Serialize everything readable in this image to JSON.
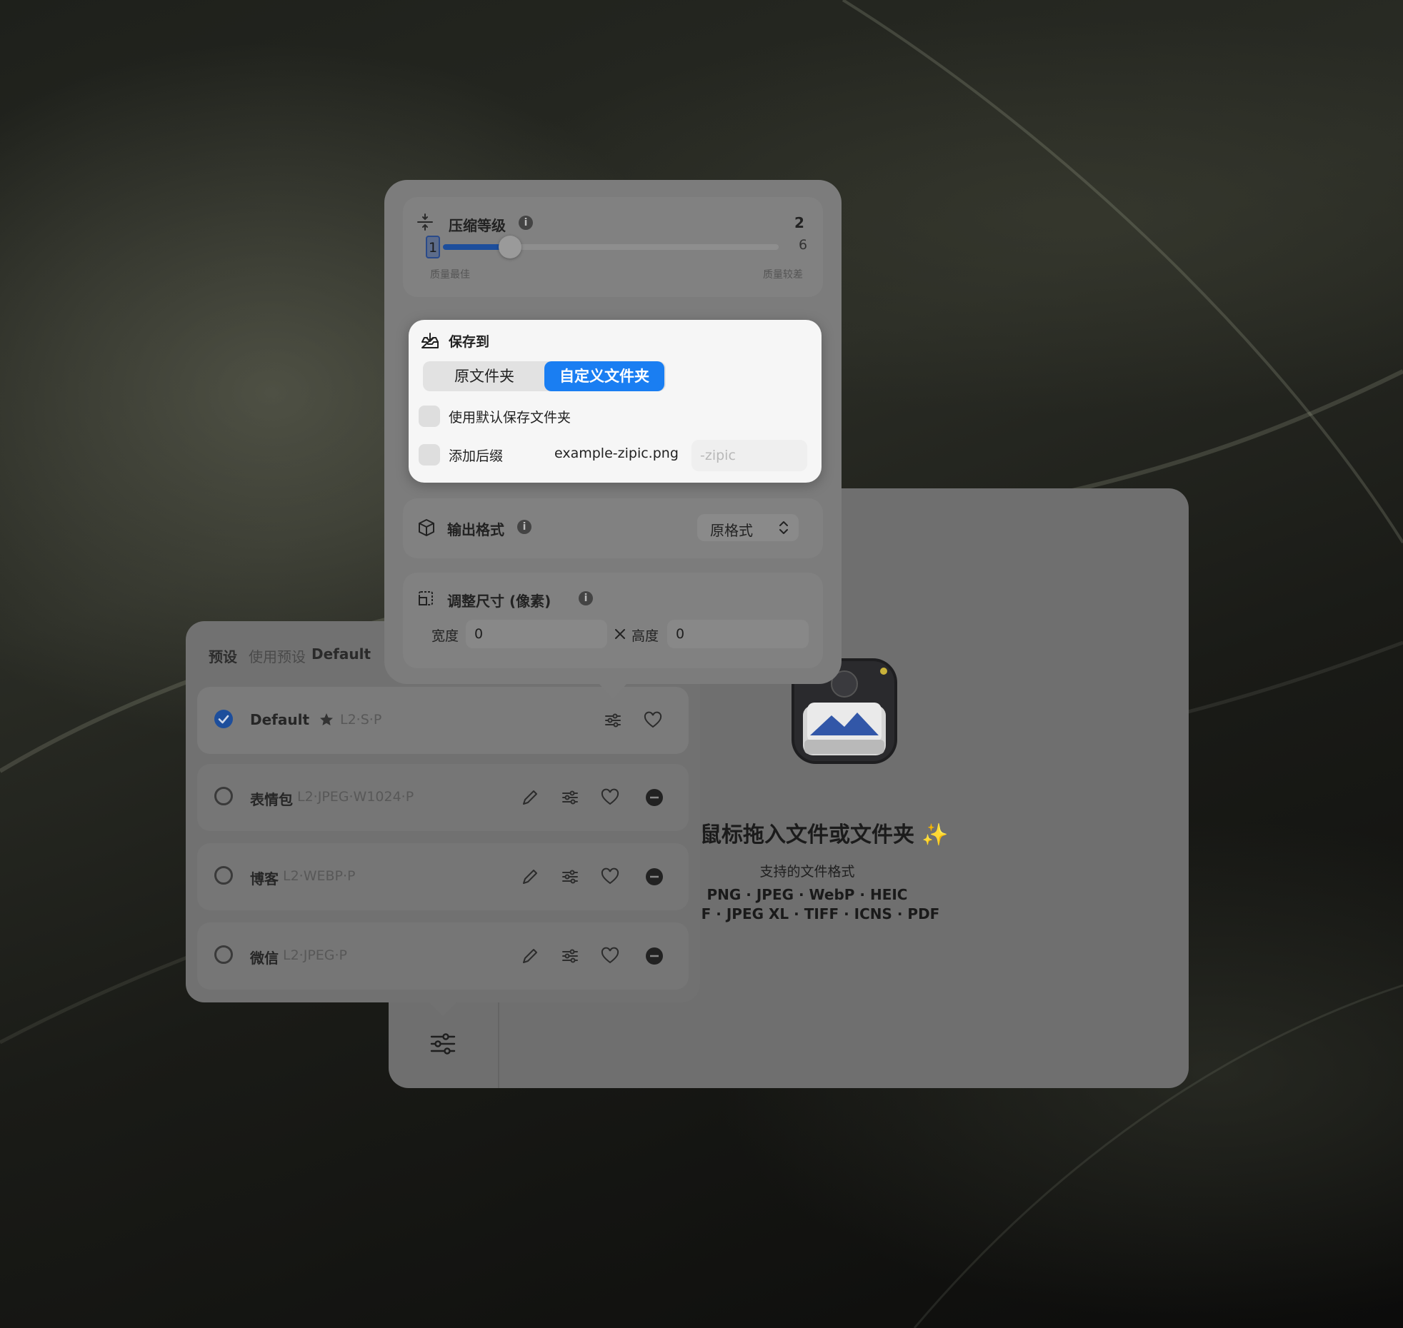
{
  "main": {
    "drop_title": "✨ 鼠标拖入文件或文件夹 ✨",
    "supported_label": "支持的文件格式",
    "formats_line1": "PNG · JPEG · WebP · HEIC",
    "formats_line2": "AVIF · JPEG XL · TIFF · ICNS · PDF"
  },
  "presets": {
    "title": "预设",
    "use_label": "使用预设",
    "current": "Default",
    "items": [
      {
        "name": "Default",
        "detail": "L2·S·P",
        "selected": true
      },
      {
        "name": "表情包",
        "detail": "L2·JPEG·W1024·P",
        "selected": false
      },
      {
        "name": "博客",
        "detail": "L2·WEBP·P",
        "selected": false
      },
      {
        "name": "微信",
        "detail": "L2·JPEG·P",
        "selected": false
      }
    ]
  },
  "settings": {
    "compression": {
      "label": "压缩等级",
      "value": "2",
      "min": "1",
      "max": "6",
      "min_caption": "质量最佳",
      "max_caption": "质量较差",
      "level": 2
    },
    "save_to": {
      "label": "保存到",
      "option_original": "原文件夹",
      "option_custom": "自定义文件夹",
      "use_default_label": "使用默认保存文件夹",
      "add_suffix_label": "添加后缀",
      "example_filename": "example-zipic.png",
      "suffix_placeholder": "-zipic"
    },
    "output_format": {
      "label": "输出格式",
      "value": "原格式"
    },
    "resize": {
      "label": "调整尺寸 (像素)",
      "width_label": "宽度",
      "width_value": "0",
      "height_label": "高度",
      "height_value": "0"
    }
  },
  "colors": {
    "accent": "#1a7ef2",
    "selected_radio": "#1d4e9c"
  }
}
